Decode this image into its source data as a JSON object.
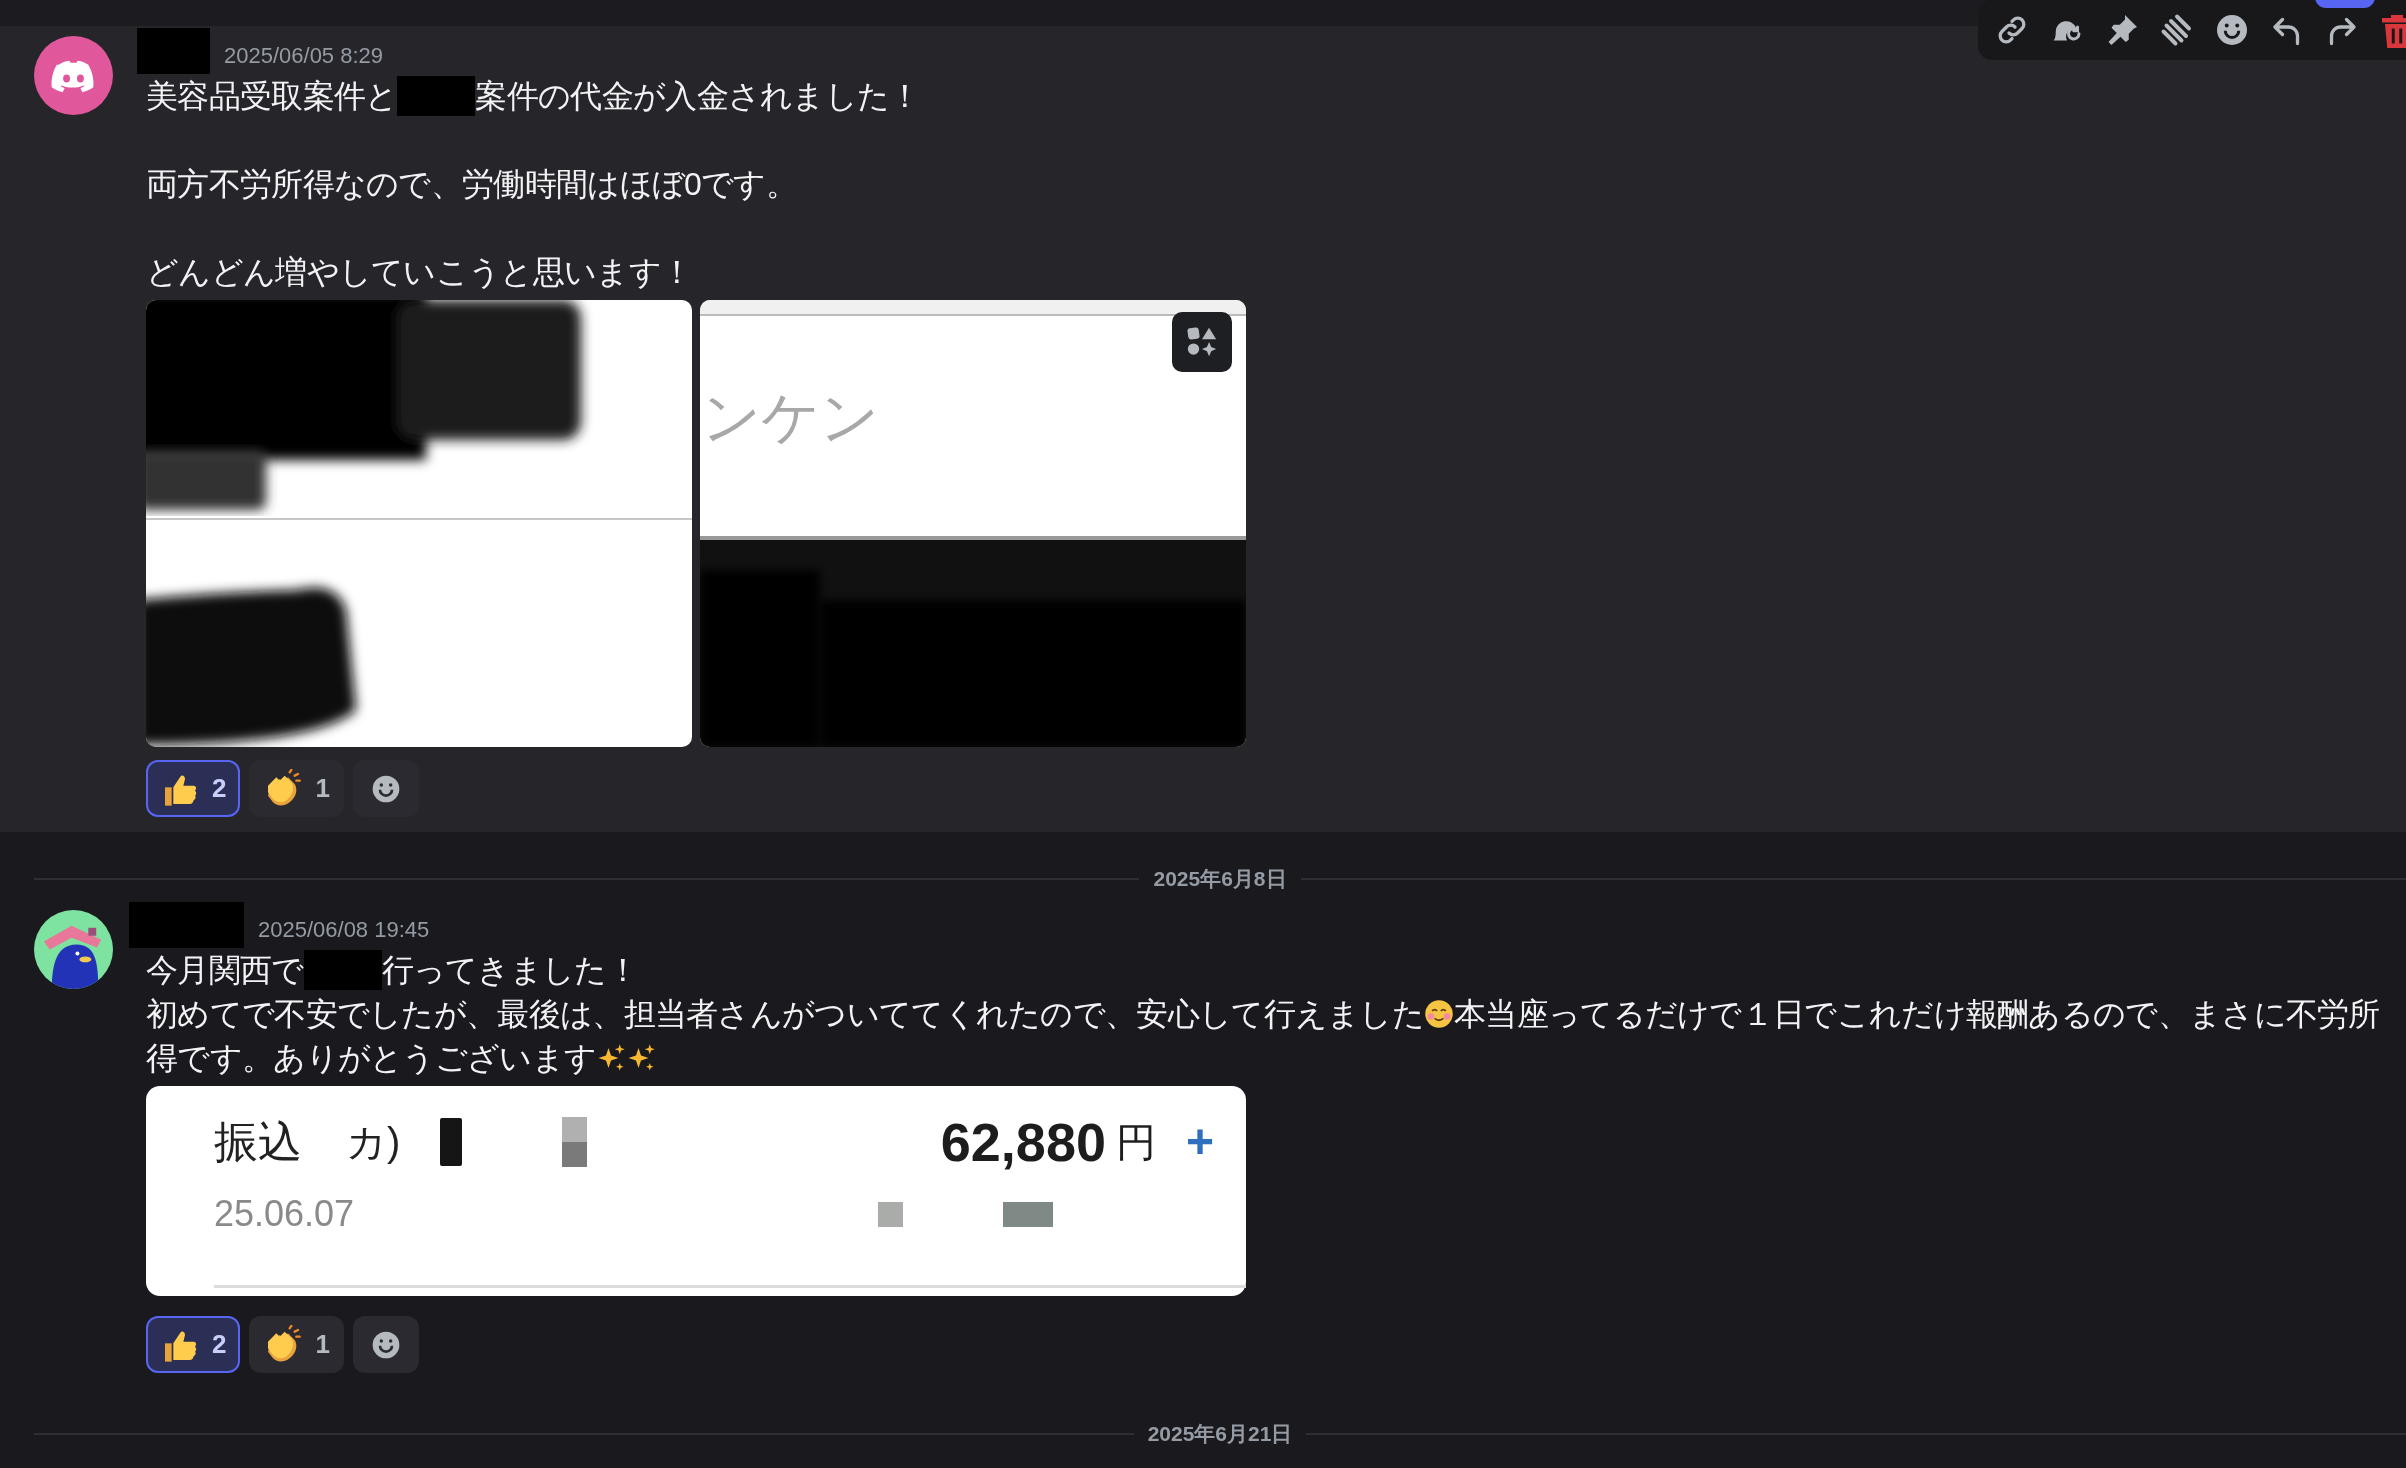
{
  "messages": [
    {
      "author_redacted": true,
      "timestamp": "2025/06/05 8:29",
      "paragraphs": [
        [
          [
            {
              "kind": "text",
              "text": "美容品受取案件と"
            },
            {
              "kind": "redacted"
            },
            {
              "kind": "text",
              "text": "案件の代金が入金されました！"
            }
          ]
        ],
        [
          [
            {
              "kind": "text",
              "text": "両方不労所得なので、労働時間はほぼ0です。"
            }
          ]
        ],
        [
          [
            {
              "kind": "text",
              "text": "どんどん増やしていこうと思います！"
            }
          ]
        ]
      ],
      "attachments": [
        {
          "kind": "document_left"
        },
        {
          "kind": "document_right",
          "text": "ンケン"
        }
      ],
      "reactions": [
        {
          "kind": "thumbs_up",
          "count": "2",
          "selected": true
        },
        {
          "kind": "clap",
          "count": "1",
          "selected": false
        }
      ],
      "hovered": true
    },
    {
      "divider": "2025年6月8日",
      "author_redacted": true,
      "timestamp": "2025/06/08 19:45",
      "paragraphs": [
        [
          [
            {
              "kind": "text",
              "text": "今月関西で"
            },
            {
              "kind": "redacted"
            },
            {
              "kind": "text",
              "text": "行ってきました！"
            }
          ],
          [
            {
              "kind": "text",
              "text": "初めてで不安でしたが、最後は、担当者さんがついててくれたので、安心して行えました"
            },
            {
              "kind": "blush_emoji"
            },
            {
              "kind": "text",
              "text": "本当座ってるだけで１日でこれだけ報酬あるので、まさに不労所"
            }
          ],
          [
            {
              "kind": "text",
              "text": "得です。ありがとうございます"
            },
            {
              "kind": "sparkles_emoji"
            },
            {
              "kind": "sparkles_emoji"
            }
          ]
        ]
      ],
      "bank_card": {
        "label": "振込",
        "payee": "カ)",
        "date": "25.06.07",
        "amount": "62,880",
        "currency": "円",
        "sign": "+"
      },
      "reactions": [
        {
          "kind": "thumbs_up",
          "count": "2",
          "selected": true
        },
        {
          "kind": "clap",
          "count": "1",
          "selected": false
        }
      ],
      "hovered": false
    }
  ],
  "next_divider": "2025年6月21日"
}
